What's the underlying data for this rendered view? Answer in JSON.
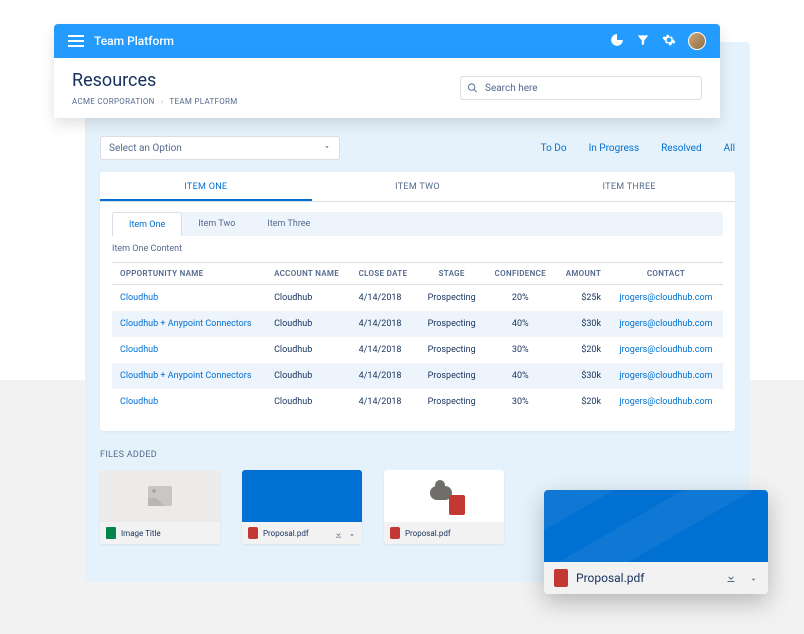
{
  "header": {
    "title": "Team Platform"
  },
  "page": {
    "title": "Resources"
  },
  "breadcrumb": {
    "org": "ACME CORPORATION",
    "section": "TEAM PLATFORM"
  },
  "search": {
    "placeholder": "Search here"
  },
  "select": {
    "placeholder": "Select an Option"
  },
  "filters": [
    "To Do",
    "In Progress",
    "Resolved",
    "All"
  ],
  "big_tabs": [
    "ITEM ONE",
    "ITEM TWO",
    "ITEM THREE"
  ],
  "sub_tabs": [
    "Item One",
    "Item Two",
    "Item Three"
  ],
  "content_label": "Item One Content",
  "table": {
    "headers": {
      "opportunity": "OPPORTUNITY NAME",
      "account": "ACCOUNT NAME",
      "close": "CLOSE DATE",
      "stage": "STAGE",
      "confidence": "CONFIDENCE",
      "amount": "AMOUNT",
      "contact": "CONTACT"
    },
    "rows": [
      {
        "opportunity": "Cloudhub",
        "account": "Cloudhub",
        "close": "4/14/2018",
        "stage": "Prospecting",
        "confidence": "20%",
        "amount": "$25k",
        "contact": "jrogers@cloudhub.com"
      },
      {
        "opportunity": "Cloudhub + Anypoint Connectors",
        "account": "Cloudhub",
        "close": "4/14/2018",
        "stage": "Prospecting",
        "confidence": "40%",
        "amount": "$30k",
        "contact": "jrogers@cloudhub.com"
      },
      {
        "opportunity": "Cloudhub",
        "account": "Cloudhub",
        "close": "4/14/2018",
        "stage": "Prospecting",
        "confidence": "30%",
        "amount": "$20k",
        "contact": "jrogers@cloudhub.com"
      },
      {
        "opportunity": "Cloudhub + Anypoint Connectors",
        "account": "Cloudhub",
        "close": "4/14/2018",
        "stage": "Prospecting",
        "confidence": "40%",
        "amount": "$30k",
        "contact": "jrogers@cloudhub.com"
      },
      {
        "opportunity": "Cloudhub",
        "account": "Cloudhub",
        "close": "4/14/2018",
        "stage": "Prospecting",
        "confidence": "30%",
        "amount": "$20k",
        "contact": "jrogers@cloudhub.com"
      }
    ]
  },
  "files": {
    "label": "FILES ADDED",
    "tiles": [
      {
        "name": "Image Title"
      },
      {
        "name": "Proposal.pdf"
      },
      {
        "name": "Proposal.pdf"
      }
    ]
  },
  "popup": {
    "name": "Proposal.pdf"
  }
}
